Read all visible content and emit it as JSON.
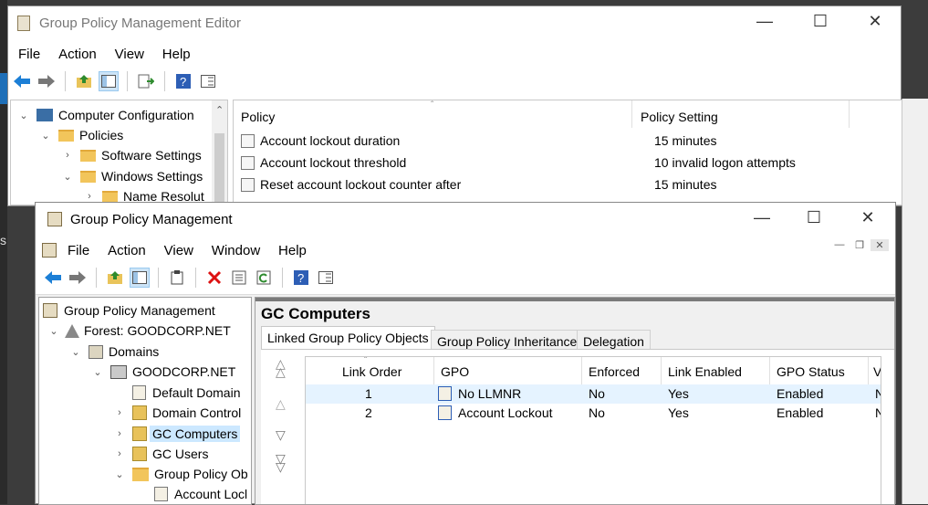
{
  "editor": {
    "title": "Group Policy Management Editor",
    "menu": [
      "File",
      "Action",
      "View",
      "Help"
    ],
    "tree": [
      "Computer Configuration",
      "Policies",
      "Software Settings",
      "Windows Settings",
      "Name Resolut"
    ],
    "columns": [
      "Policy",
      "Policy Setting"
    ],
    "rows": [
      {
        "policy": "Account lockout duration",
        "setting": "15 minutes"
      },
      {
        "policy": "Account lockout threshold",
        "setting": "10 invalid logon attempts"
      },
      {
        "policy": "Reset account lockout counter after",
        "setting": "15 minutes"
      }
    ]
  },
  "gpm": {
    "title": "Group Policy Management",
    "menu": [
      "File",
      "Action",
      "View",
      "Window",
      "Help"
    ],
    "tree": [
      "Group Policy Management",
      "Forest: GOODCORP.NET",
      "Domains",
      "GOODCORP.NET",
      "Default Domain",
      "Domain Control",
      "GC Computers",
      "GC Users",
      "Group Policy Ob",
      "Account Locl"
    ],
    "heading": "GC Computers",
    "tabs": [
      "Linked Group Policy Objects",
      "Group Policy Inheritance",
      "Delegation"
    ],
    "columns": [
      "Link Order",
      "GPO",
      "Enforced",
      "Link Enabled",
      "GPO Status",
      "V"
    ],
    "rows": [
      {
        "order": "1",
        "gpo": "No LLMNR",
        "enforced": "No",
        "enabled": "Yes",
        "status": "Enabled",
        "w": "N"
      },
      {
        "order": "2",
        "gpo": "Account Lockout",
        "enforced": "No",
        "enabled": "Yes",
        "status": "Enabled",
        "w": "N"
      }
    ]
  },
  "colors": {
    "selection": "#cce8ff",
    "rowhover": "#e5f3ff",
    "accent": "#0078d7"
  }
}
